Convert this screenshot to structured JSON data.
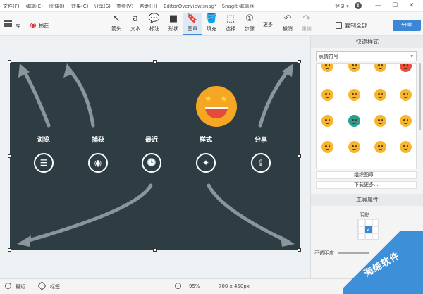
{
  "titlebar": {
    "menus": [
      "文件(F)",
      "编辑(E)",
      "图像(I)",
      "效果(C)",
      "分享(S)",
      "查看(V)",
      "帮助(H)"
    ],
    "doc_title": "EditorOverview.snag* - Snagit 编辑器",
    "login": "登录",
    "login_caret": "▾",
    "info": "i",
    "win_controls": [
      "—",
      "☐",
      "✕"
    ]
  },
  "toolbar": {
    "library": "库",
    "capture": "捕获",
    "tools": [
      {
        "icon": "↖",
        "label": "箭头"
      },
      {
        "icon": "a",
        "label": "文本"
      },
      {
        "icon": "💬",
        "label": "标注"
      },
      {
        "icon": "■",
        "label": "形状"
      },
      {
        "icon": "🔖",
        "label": "图章"
      },
      {
        "icon": "🪣",
        "label": "填充"
      },
      {
        "icon": "⬚",
        "label": "选择"
      },
      {
        "icon": "①",
        "label": "步骤"
      }
    ],
    "more": "更多",
    "undo": {
      "icon": "↶",
      "label": "撤消"
    },
    "redo": {
      "icon": "↷",
      "label": "重做"
    },
    "copy_all": "复制全部",
    "share": "分享"
  },
  "image": {
    "labels": [
      "浏览",
      "捕获",
      "最近",
      "样式",
      "分享"
    ],
    "icons": [
      "☰",
      "◉",
      "🕒",
      "✦",
      "⇪"
    ],
    "star": "★"
  },
  "right_panel": {
    "quick_styles": "快速样式",
    "stamp_category": "表情符号",
    "dropdown_arrow": "▾",
    "organize": "组织图章...",
    "download_more": "下载更多...",
    "tool_properties": "工具属性",
    "shadow": "阴影",
    "shadow_check": "✓",
    "opacity": "不透明度"
  },
  "statusbar": {
    "recent": "最近",
    "tags": "标签",
    "zoom": "95%",
    "size": "700 x 450px"
  },
  "watermark": "海绵软件"
}
